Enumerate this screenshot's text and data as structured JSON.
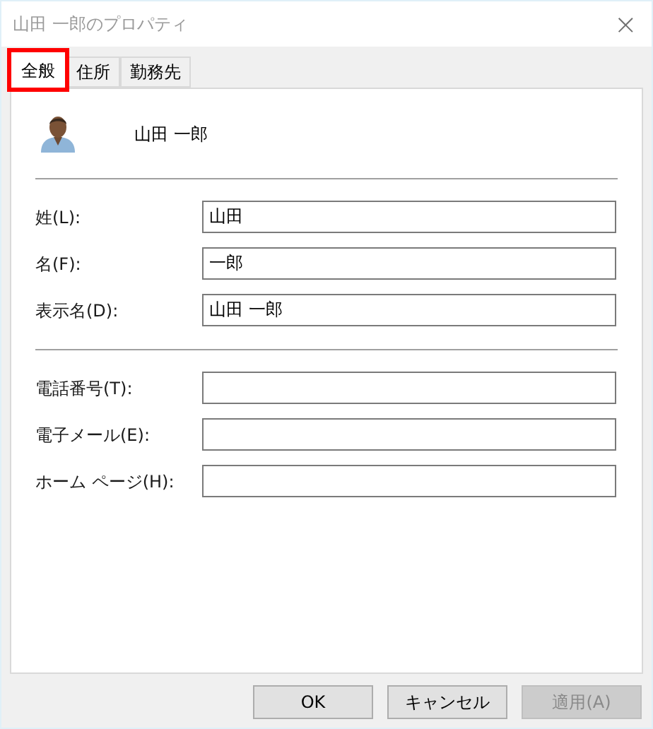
{
  "window": {
    "title": "山田 一郎のプロパティ",
    "close": "×"
  },
  "tabs": [
    {
      "label": "全般",
      "selected": true,
      "highlighted": true
    },
    {
      "label": "住所",
      "selected": false,
      "highlighted": false
    },
    {
      "label": "勤務先",
      "selected": false,
      "highlighted": false
    }
  ],
  "contact": {
    "name": "山田 一郎"
  },
  "name_fields": [
    {
      "label": "姓(L):",
      "value": "山田"
    },
    {
      "label": "名(F):",
      "value": "一郎"
    },
    {
      "label": "表示名(D):",
      "value": "山田 一郎"
    }
  ],
  "contact_fields": [
    {
      "label": "電話番号(T):"
    },
    {
      "label": "電子メール(E):"
    },
    {
      "label": "ホーム ページ(H):"
    }
  ],
  "buttons": [
    {
      "label": "OK",
      "disabled": false
    },
    {
      "label": "キャンセル",
      "disabled": false
    },
    {
      "label": "適用(A)",
      "disabled": true
    }
  ]
}
